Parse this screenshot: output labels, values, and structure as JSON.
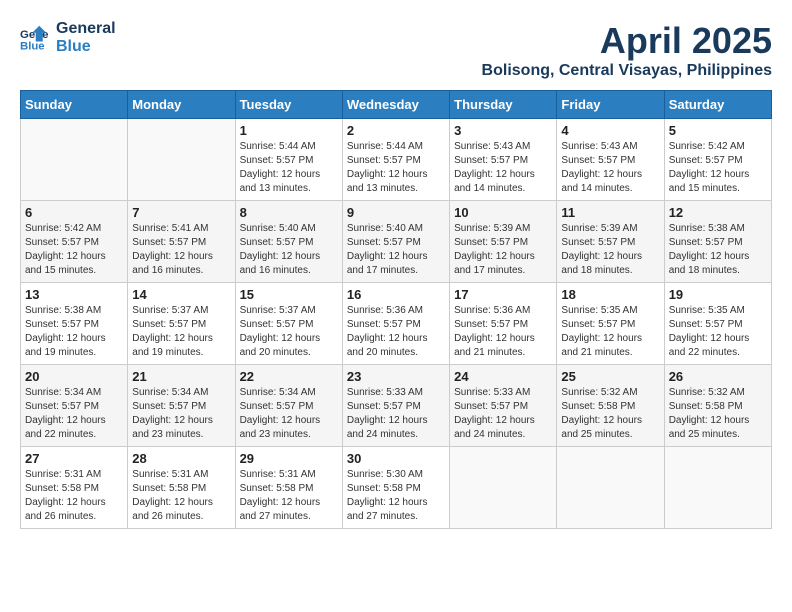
{
  "header": {
    "logo_line1": "General",
    "logo_line2": "Blue",
    "month": "April 2025",
    "location": "Bolisong, Central Visayas, Philippines"
  },
  "weekdays": [
    "Sunday",
    "Monday",
    "Tuesday",
    "Wednesday",
    "Thursday",
    "Friday",
    "Saturday"
  ],
  "weeks": [
    [
      {
        "day": "",
        "sunrise": "",
        "sunset": "",
        "daylight": ""
      },
      {
        "day": "",
        "sunrise": "",
        "sunset": "",
        "daylight": ""
      },
      {
        "day": "1",
        "sunrise": "Sunrise: 5:44 AM",
        "sunset": "Sunset: 5:57 PM",
        "daylight": "Daylight: 12 hours and 13 minutes."
      },
      {
        "day": "2",
        "sunrise": "Sunrise: 5:44 AM",
        "sunset": "Sunset: 5:57 PM",
        "daylight": "Daylight: 12 hours and 13 minutes."
      },
      {
        "day": "3",
        "sunrise": "Sunrise: 5:43 AM",
        "sunset": "Sunset: 5:57 PM",
        "daylight": "Daylight: 12 hours and 14 minutes."
      },
      {
        "day": "4",
        "sunrise": "Sunrise: 5:43 AM",
        "sunset": "Sunset: 5:57 PM",
        "daylight": "Daylight: 12 hours and 14 minutes."
      },
      {
        "day": "5",
        "sunrise": "Sunrise: 5:42 AM",
        "sunset": "Sunset: 5:57 PM",
        "daylight": "Daylight: 12 hours and 15 minutes."
      }
    ],
    [
      {
        "day": "6",
        "sunrise": "Sunrise: 5:42 AM",
        "sunset": "Sunset: 5:57 PM",
        "daylight": "Daylight: 12 hours and 15 minutes."
      },
      {
        "day": "7",
        "sunrise": "Sunrise: 5:41 AM",
        "sunset": "Sunset: 5:57 PM",
        "daylight": "Daylight: 12 hours and 16 minutes."
      },
      {
        "day": "8",
        "sunrise": "Sunrise: 5:40 AM",
        "sunset": "Sunset: 5:57 PM",
        "daylight": "Daylight: 12 hours and 16 minutes."
      },
      {
        "day": "9",
        "sunrise": "Sunrise: 5:40 AM",
        "sunset": "Sunset: 5:57 PM",
        "daylight": "Daylight: 12 hours and 17 minutes."
      },
      {
        "day": "10",
        "sunrise": "Sunrise: 5:39 AM",
        "sunset": "Sunset: 5:57 PM",
        "daylight": "Daylight: 12 hours and 17 minutes."
      },
      {
        "day": "11",
        "sunrise": "Sunrise: 5:39 AM",
        "sunset": "Sunset: 5:57 PM",
        "daylight": "Daylight: 12 hours and 18 minutes."
      },
      {
        "day": "12",
        "sunrise": "Sunrise: 5:38 AM",
        "sunset": "Sunset: 5:57 PM",
        "daylight": "Daylight: 12 hours and 18 minutes."
      }
    ],
    [
      {
        "day": "13",
        "sunrise": "Sunrise: 5:38 AM",
        "sunset": "Sunset: 5:57 PM",
        "daylight": "Daylight: 12 hours and 19 minutes."
      },
      {
        "day": "14",
        "sunrise": "Sunrise: 5:37 AM",
        "sunset": "Sunset: 5:57 PM",
        "daylight": "Daylight: 12 hours and 19 minutes."
      },
      {
        "day": "15",
        "sunrise": "Sunrise: 5:37 AM",
        "sunset": "Sunset: 5:57 PM",
        "daylight": "Daylight: 12 hours and 20 minutes."
      },
      {
        "day": "16",
        "sunrise": "Sunrise: 5:36 AM",
        "sunset": "Sunset: 5:57 PM",
        "daylight": "Daylight: 12 hours and 20 minutes."
      },
      {
        "day": "17",
        "sunrise": "Sunrise: 5:36 AM",
        "sunset": "Sunset: 5:57 PM",
        "daylight": "Daylight: 12 hours and 21 minutes."
      },
      {
        "day": "18",
        "sunrise": "Sunrise: 5:35 AM",
        "sunset": "Sunset: 5:57 PM",
        "daylight": "Daylight: 12 hours and 21 minutes."
      },
      {
        "day": "19",
        "sunrise": "Sunrise: 5:35 AM",
        "sunset": "Sunset: 5:57 PM",
        "daylight": "Daylight: 12 hours and 22 minutes."
      }
    ],
    [
      {
        "day": "20",
        "sunrise": "Sunrise: 5:34 AM",
        "sunset": "Sunset: 5:57 PM",
        "daylight": "Daylight: 12 hours and 22 minutes."
      },
      {
        "day": "21",
        "sunrise": "Sunrise: 5:34 AM",
        "sunset": "Sunset: 5:57 PM",
        "daylight": "Daylight: 12 hours and 23 minutes."
      },
      {
        "day": "22",
        "sunrise": "Sunrise: 5:34 AM",
        "sunset": "Sunset: 5:57 PM",
        "daylight": "Daylight: 12 hours and 23 minutes."
      },
      {
        "day": "23",
        "sunrise": "Sunrise: 5:33 AM",
        "sunset": "Sunset: 5:57 PM",
        "daylight": "Daylight: 12 hours and 24 minutes."
      },
      {
        "day": "24",
        "sunrise": "Sunrise: 5:33 AM",
        "sunset": "Sunset: 5:57 PM",
        "daylight": "Daylight: 12 hours and 24 minutes."
      },
      {
        "day": "25",
        "sunrise": "Sunrise: 5:32 AM",
        "sunset": "Sunset: 5:58 PM",
        "daylight": "Daylight: 12 hours and 25 minutes."
      },
      {
        "day": "26",
        "sunrise": "Sunrise: 5:32 AM",
        "sunset": "Sunset: 5:58 PM",
        "daylight": "Daylight: 12 hours and 25 minutes."
      }
    ],
    [
      {
        "day": "27",
        "sunrise": "Sunrise: 5:31 AM",
        "sunset": "Sunset: 5:58 PM",
        "daylight": "Daylight: 12 hours and 26 minutes."
      },
      {
        "day": "28",
        "sunrise": "Sunrise: 5:31 AM",
        "sunset": "Sunset: 5:58 PM",
        "daylight": "Daylight: 12 hours and 26 minutes."
      },
      {
        "day": "29",
        "sunrise": "Sunrise: 5:31 AM",
        "sunset": "Sunset: 5:58 PM",
        "daylight": "Daylight: 12 hours and 27 minutes."
      },
      {
        "day": "30",
        "sunrise": "Sunrise: 5:30 AM",
        "sunset": "Sunset: 5:58 PM",
        "daylight": "Daylight: 12 hours and 27 minutes."
      },
      {
        "day": "",
        "sunrise": "",
        "sunset": "",
        "daylight": ""
      },
      {
        "day": "",
        "sunrise": "",
        "sunset": "",
        "daylight": ""
      },
      {
        "day": "",
        "sunrise": "",
        "sunset": "",
        "daylight": ""
      }
    ]
  ]
}
